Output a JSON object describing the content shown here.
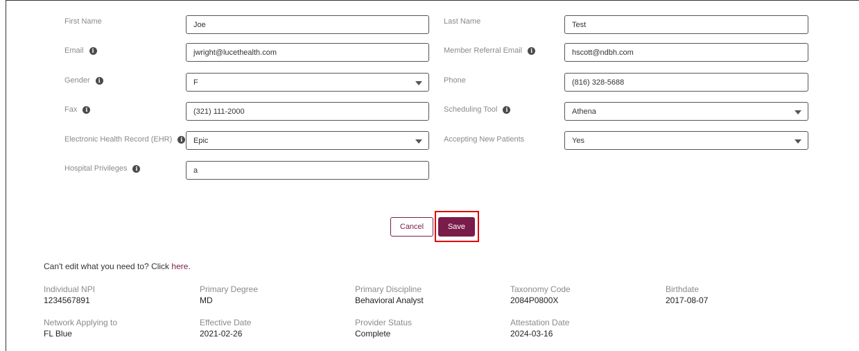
{
  "form": {
    "first_name_label": "First Name",
    "first_name": "Joe",
    "last_name_label": "Last Name",
    "last_name": "Test",
    "email_label": "Email",
    "email": "jwright@lucethealth.com",
    "member_referral_email_label": "Member Referral Email",
    "member_referral_email": "hscott@ndbh.com",
    "gender_label": "Gender",
    "gender": "F",
    "phone_label": "Phone",
    "phone": "(816) 328-5688",
    "fax_label": "Fax",
    "fax": "(321) 111-2000",
    "scheduling_tool_label": "Scheduling Tool",
    "scheduling_tool": "Athena",
    "ehr_label": "Electronic Health Record (EHR)",
    "ehr": "Epic",
    "accepting_label": "Accepting New Patients",
    "accepting": "Yes",
    "hospital_label": "Hospital Privileges",
    "hospital": "a"
  },
  "actions": {
    "cancel_label": "Cancel",
    "save_label": "Save"
  },
  "help": {
    "prefix": "Can't edit what you need to? Click ",
    "link": "here",
    "suffix": "."
  },
  "details": {
    "individual_npi_label": "Individual NPI",
    "individual_npi": "1234567891",
    "primary_degree_label": "Primary Degree",
    "primary_degree": "MD",
    "primary_discipline_label": "Primary Discipline",
    "primary_discipline": "Behavioral Analyst",
    "taxonomy_code_label": "Taxonomy Code",
    "taxonomy_code": "2084P0800X",
    "birthdate_label": "Birthdate",
    "birthdate": "2017-08-07",
    "network_label": "Network Applying to",
    "network": "FL Blue",
    "effective_date_label": "Effective Date",
    "effective_date": "2021-02-26",
    "provider_status_label": "Provider Status",
    "provider_status": "Complete",
    "attestation_date_label": "Attestation Date",
    "attestation_date": "2024-03-16"
  },
  "colors": {
    "brand": "#7a1c4a",
    "highlight": "#e00000"
  }
}
